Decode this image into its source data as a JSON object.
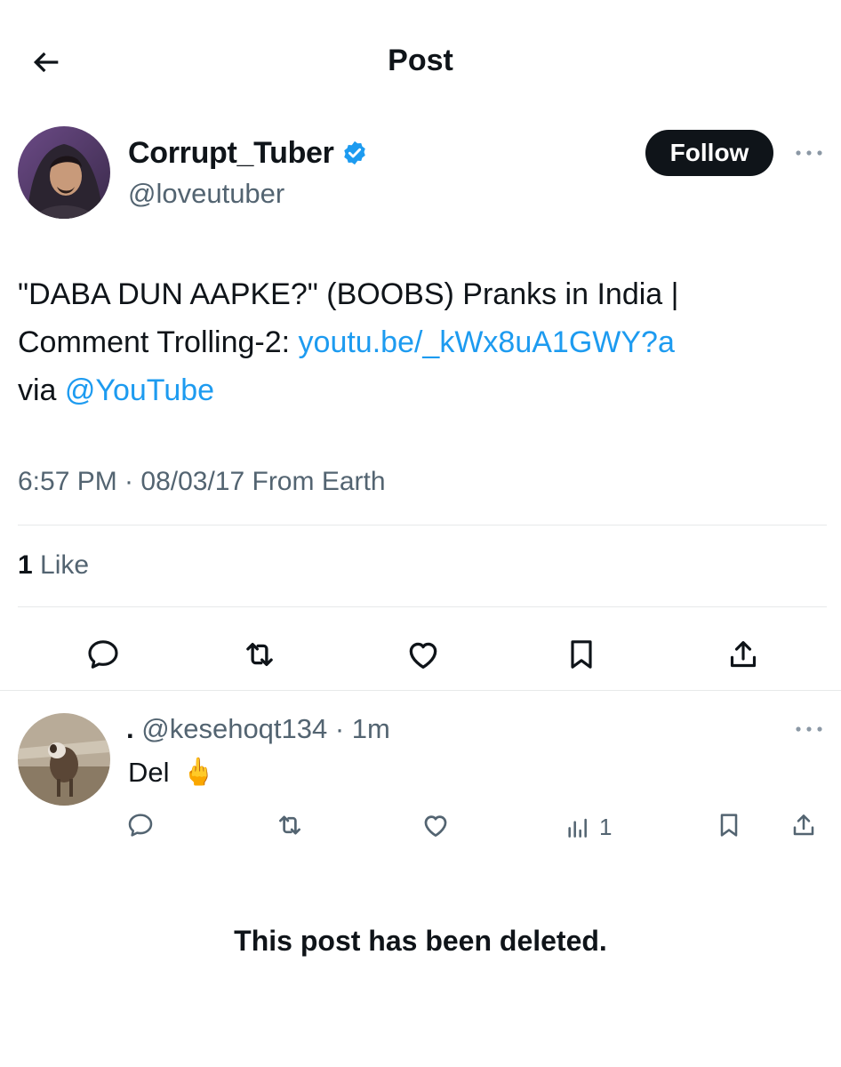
{
  "header": {
    "title": "Post"
  },
  "post": {
    "author_name": "Corrupt_Tuber",
    "author_handle": "@loveutuber",
    "follow_label": "Follow",
    "text_part1": "\"DABA DUN AAPKE?\" (BOOBS) Pranks in India | Comment Trolling-2: ",
    "link_url": "youtu.be/_kWx8uA1GWY?a",
    "text_via": "via ",
    "mention": "@YouTube",
    "timestamp": "6:57 PM · 08/03/17 From Earth",
    "likes_count": "1",
    "likes_label": "Like"
  },
  "reply": {
    "display_name": ".",
    "handle_time": "@kesehoqt134 · 1m",
    "text": "Del",
    "emoji": "🖕",
    "views_count": "1"
  },
  "deleted_notice": "This post has been deleted.",
  "colors": {
    "text": "#0f1419",
    "secondary": "#536471",
    "link": "#1d9bf0",
    "verified": "#1d9bf0",
    "divider": "#e7e9ea"
  },
  "icons": [
    "back-arrow-icon",
    "verified-badge-icon",
    "more-icon",
    "reply-icon",
    "repost-icon",
    "like-icon",
    "bookmark-icon",
    "share-icon",
    "views-icon"
  ]
}
